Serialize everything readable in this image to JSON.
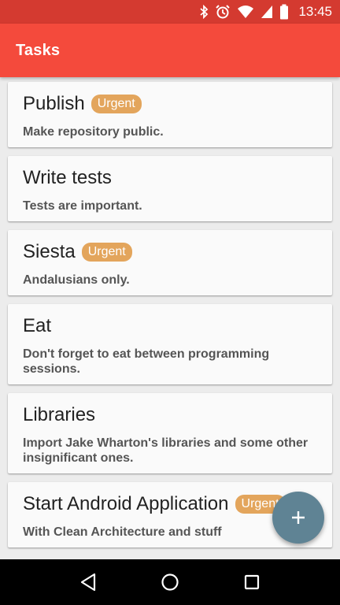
{
  "status_bar": {
    "time": "13:45",
    "icons": [
      "bluetooth-icon",
      "alarm-icon",
      "wifi-icon",
      "signal-icon",
      "battery-icon"
    ]
  },
  "app_bar": {
    "title": "Tasks"
  },
  "tasks": [
    {
      "title": "Publish",
      "urgent": true,
      "badge": "Urgent",
      "description": "Make repository public."
    },
    {
      "title": "Write tests",
      "urgent": false,
      "badge": "",
      "description": "Tests are important."
    },
    {
      "title": "Siesta",
      "urgent": true,
      "badge": "Urgent",
      "description": "Andalusians only."
    },
    {
      "title": "Eat",
      "urgent": false,
      "badge": "",
      "description": "Don't forget to eat between programming sessions."
    },
    {
      "title": "Libraries",
      "urgent": false,
      "badge": "",
      "description": "Import Jake Wharton's libraries and some other insignificant ones."
    },
    {
      "title": "Start Android Application",
      "urgent": true,
      "badge": "Urgent",
      "description": "With Clean Architecture and stuff"
    }
  ],
  "fab": {
    "icon": "plus-icon"
  },
  "nav_bar": {
    "icons": [
      "back-icon",
      "home-icon",
      "recents-icon"
    ]
  },
  "colors": {
    "status_bar": "#d43a30",
    "app_bar": "#f44a3c",
    "badge": "#e3a55c",
    "fab": "#5f8394",
    "background": "#ececec"
  }
}
